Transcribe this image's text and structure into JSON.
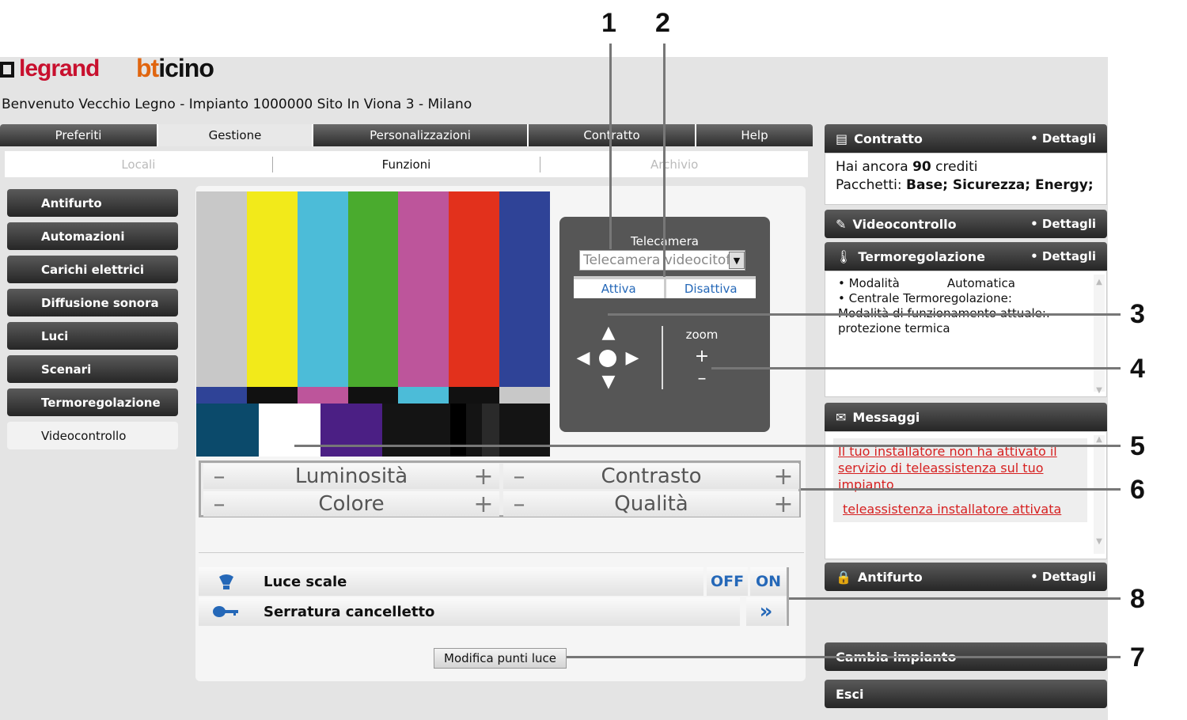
{
  "brand": {
    "legrand": "legrand",
    "bticino": "bticino",
    "bticino_prefix": "bt",
    "bticino_rest": "icino"
  },
  "welcome": "Benvenuto Vecchio Legno - Impianto 1000000 Sito In Viona 3 - Milano",
  "nav": {
    "tabs": [
      "Preferiti",
      "Gestione",
      "Personalizzazioni",
      "Contratto",
      "Help"
    ],
    "active": 1
  },
  "subnav": {
    "tabs": [
      "Locali",
      "Funzioni",
      "Archivio"
    ],
    "active": 1
  },
  "sidebar": {
    "items": [
      "Antifurto",
      "Automazioni",
      "Carichi elettrici",
      "Diffusione sonora",
      "Luci",
      "Scenari",
      "Termoregolazione",
      "Videocontrollo"
    ],
    "active": 7
  },
  "camera": {
    "label": "Telecamera",
    "select_value": "Telecamera videocitofono",
    "activate": "Attiva",
    "deactivate": "Disattiva",
    "zoom_label": "zoom",
    "zoom_in": "+",
    "zoom_out": "–"
  },
  "adjust": {
    "minus": "–",
    "plus": "+",
    "luminosita": "Luminosità",
    "contrasto": "Contrasto",
    "colore": "Colore",
    "qualita": "Qualità"
  },
  "devices": [
    {
      "label": "Luce scale",
      "off": "OFF",
      "on": "ON",
      "icon": "lightbulb-icon"
    },
    {
      "label": "Serratura cancelletto",
      "go": "»",
      "icon": "key-icon"
    }
  ],
  "modifica": "Modifica punti luce",
  "panels": {
    "contratto": {
      "title": "Contratto",
      "details": "• Dettagli",
      "line1_pre": "Hai ancora ",
      "line1_num": "90",
      "line1_post": " crediti",
      "line2_pre": "Pacchetti: ",
      "line2_val": "Base; Sicurezza; Energy;"
    },
    "videocontrollo": {
      "title": "Videocontrollo",
      "details": "• Dettagli"
    },
    "termoregolazione": {
      "title": "Termoregolazione",
      "details": "• Dettagli",
      "mode_label": "• Modalità",
      "mode_value": "Automatica",
      "central": "• Centrale Termoregolazione:",
      "current": "Modalità di funzionamento attuale:.",
      "protection": "protezione termica"
    },
    "messaggi": {
      "title": "Messaggi",
      "msg1": "Il tuo installatore non ha attivato il servizio di teleassistenza sul tuo impianto",
      "msg2": "teleassistenza installatore attivata"
    },
    "antifurto": {
      "title": "Antifurto",
      "details": "• Dettagli"
    },
    "cambia": {
      "title": "Cambia impianto"
    },
    "esci": {
      "title": "Esci"
    }
  },
  "callouts": [
    "1",
    "2",
    "3",
    "4",
    "5",
    "6",
    "8",
    "7"
  ],
  "colors": {
    "accent_blue": "#2568b8",
    "alert_red": "#d62020",
    "dark_bar": "#333333"
  }
}
